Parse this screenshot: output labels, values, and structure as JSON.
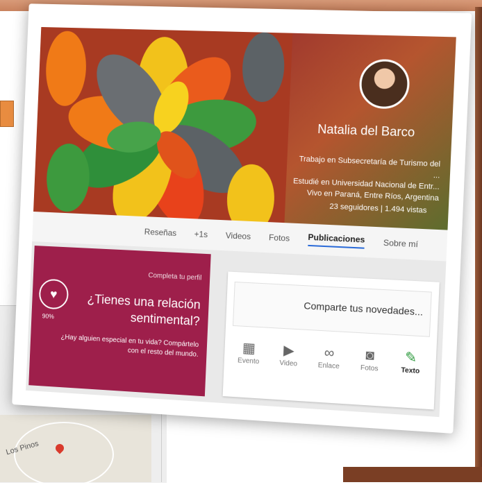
{
  "profile": {
    "name": "Natalia del Barco",
    "info": [
      "Trabajo en Subsecretaría de Turismo del ...",
      "Estudié en Universidad Nacional de Entr...",
      "Vivo en Paraná, Entre Ríos, Argentina"
    ],
    "stats": "23 seguidores | 1.494 vistas"
  },
  "tabs": [
    {
      "label": "Sobre mí"
    },
    {
      "label": "Publicaciones"
    },
    {
      "label": "Fotos"
    },
    {
      "label": "Videos"
    },
    {
      "label": "+1s"
    },
    {
      "label": "Reseñas"
    }
  ],
  "suggestion": {
    "kicker": "Completa tu perfil",
    "title": "¿Tienes una relación sentimental?",
    "subtitle": "¿Hay alguien especial en tu vida? Compártelo con el resto del mundo.",
    "percent": "90%"
  },
  "composer": {
    "placeholder": "Comparte tus novedades...",
    "actions": [
      {
        "label": "Texto",
        "icon": "pencil-icon"
      },
      {
        "label": "Fotos",
        "icon": "camera-icon"
      },
      {
        "label": "Enlace",
        "icon": "link-icon"
      },
      {
        "label": "Video",
        "icon": "video-icon"
      },
      {
        "label": "Evento",
        "icon": "calendar-icon"
      }
    ]
  },
  "map": {
    "label": "Los Pinos"
  },
  "colors": {
    "accent_tab": "#2a6ad8",
    "suggestion_bg": "#9e1f4b",
    "text_icon": "#2e9a3e"
  }
}
